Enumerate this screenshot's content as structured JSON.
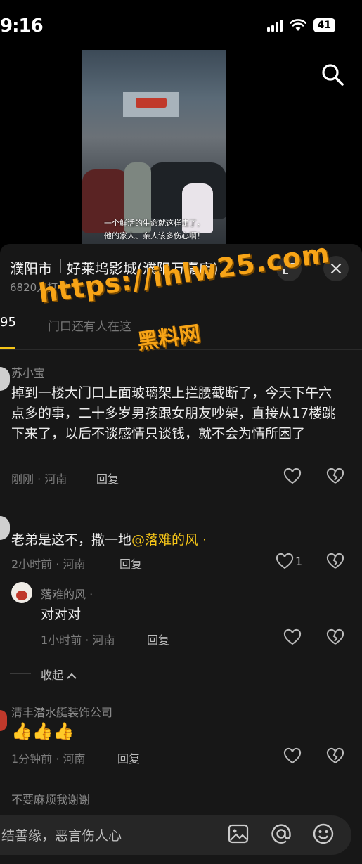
{
  "status_bar": {
    "time": "9:16",
    "battery": "41"
  },
  "video": {
    "caption_line1": "一个鲜活的生命就这样走了，",
    "caption_line2": "他的家人、亲人该多伤心啊！"
  },
  "location": {
    "city": "濮阳市",
    "venue": "好莱坞影城(濮阳万嘉店)",
    "checkins": "6820人打卡"
  },
  "tabs": {
    "count": "95",
    "second": "门口还有人在这"
  },
  "watermark": {
    "url": "https://ihlw25.com",
    "name": "黑料网"
  },
  "comments": [
    {
      "user": "苏小宝",
      "text": "掉到一楼大门口上面玻璃架上拦腰截断了，今天下午六点多的事，二十多岁男孩跟女朋友吵架，直接从17楼跳下来了，以后不谈感情只谈钱，就不会为情所困了",
      "meta": "刚刚 · 河南",
      "reply": "回复"
    },
    {
      "user": "",
      "text": "老弟是这不，撒一地",
      "mention": "@落难的风 ·",
      "meta": "2小时前 · 河南",
      "reply": "回复",
      "likes": "1"
    },
    {
      "user": "落难的风 ·",
      "text": "对对对",
      "meta": "1小时前 · 河南",
      "reply": "回复"
    },
    {
      "user": "清丰潜水艇装饰公司",
      "text": "👍👍👍",
      "meta": "1分钟前 · 河南",
      "reply": "回复"
    },
    {
      "user": "不要麻烦我谢谢"
    }
  ],
  "collapse_label": "收起",
  "input": {
    "placeholder": "结善缘，恶言伤人心"
  },
  "icons": {
    "search": "search-icon",
    "expand": "expand-icon",
    "close": "close-icon",
    "like": "heart-icon",
    "dislike": "broken-heart-icon",
    "image": "image-icon",
    "at": "at-icon",
    "emoji": "emoji-icon"
  },
  "colors": {
    "accent": "#f5c518",
    "sheet": "#171717",
    "watermark": "#f7a417"
  }
}
